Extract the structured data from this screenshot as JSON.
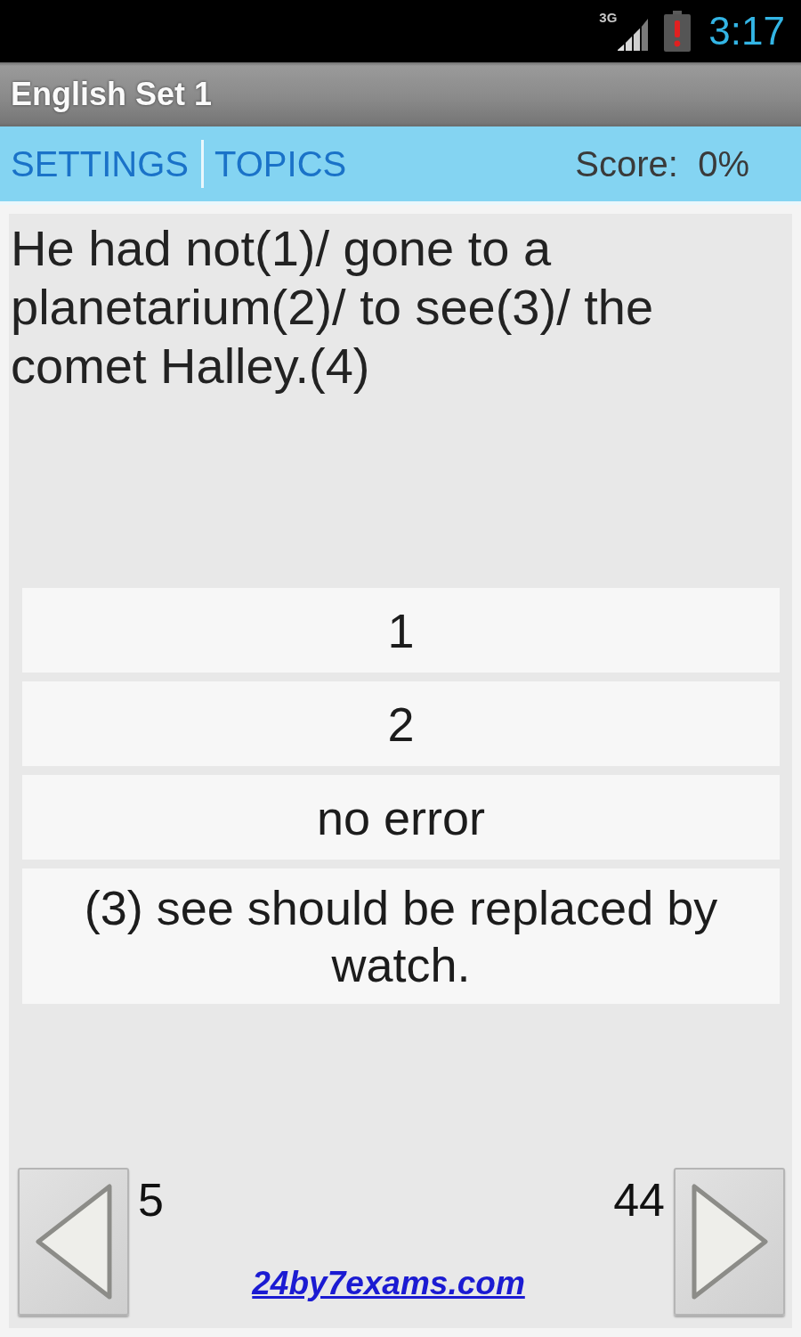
{
  "status_bar": {
    "network_label": "3G",
    "time": "3:17"
  },
  "title_bar": {
    "title": "English Set 1"
  },
  "toolbar": {
    "actions": [
      {
        "label": "SETTINGS"
      },
      {
        "label": "TOPICS"
      }
    ],
    "score": "Score:  0%"
  },
  "question": {
    "text": "He had not(1)/ gone to a planetarium(2)/ to see(3)/ the comet Halley.(4)"
  },
  "options": [
    {
      "label": "1"
    },
    {
      "label": "2"
    },
    {
      "label": "no error"
    },
    {
      "label": "(3) see should be replaced by watch."
    }
  ],
  "navigation": {
    "previous_count": "5",
    "next_count": "44",
    "link": "24by7exams.com"
  }
}
